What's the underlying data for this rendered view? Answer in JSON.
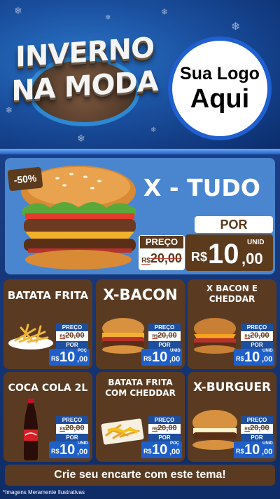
{
  "header": {
    "title_line1": "INVERNO",
    "title_line2": "NA MODA",
    "logo_line1": "Sua Logo",
    "logo_line2": "Aqui"
  },
  "featured": {
    "discount": "-50%",
    "name": "X - TUDO",
    "preco_label": "PREÇO",
    "old_currency": "R$",
    "old_price": "20,00",
    "por_label": "POR",
    "currency": "R$",
    "price_int": "10",
    "price_dec": ",00",
    "unit": "UNID"
  },
  "items": [
    {
      "name": "BATATA FRITA",
      "preco_label": "PREÇO",
      "old_currency": "R$",
      "old_price": "20,00",
      "por_label": "POR",
      "currency": "R$",
      "price_int": "10",
      "price_dec": ",00",
      "unit": "POÇ"
    },
    {
      "name": "X-BACON",
      "preco_label": "PREÇO",
      "old_currency": "R$",
      "old_price": "20,00",
      "por_label": "POR",
      "currency": "R$",
      "price_int": "10",
      "price_dec": ",00",
      "unit": "UNID"
    },
    {
      "name": "X BACON E CHEDDAR",
      "preco_label": "PREÇO",
      "old_currency": "R$",
      "old_price": "20,00",
      "por_label": "POR",
      "currency": "R$",
      "price_int": "10",
      "price_dec": ",00",
      "unit": "UNID"
    },
    {
      "name": "COCA COLA 2L",
      "preco_label": "PREÇO",
      "old_currency": "R$",
      "old_price": "20,00",
      "por_label": "POR",
      "currency": "R$",
      "price_int": "10",
      "price_dec": ",00",
      "unit": "UNID"
    },
    {
      "name": "BATATA FRITA COM CHEDDAR",
      "preco_label": "PREÇO",
      "old_currency": "R$",
      "old_price": "20,00",
      "por_label": "POR",
      "currency": "R$",
      "price_int": "10",
      "price_dec": ",00",
      "unit": "POÇ"
    },
    {
      "name": "X-BURGUER",
      "preco_label": "PREÇO",
      "old_currency": "R$",
      "old_price": "20,00",
      "por_label": "POR",
      "currency": "R$",
      "price_int": "10",
      "price_dec": ",00",
      "unit": "UNID"
    }
  ],
  "cta": "Crie seu encarte com este tema!",
  "footnote": "*Imagens Meramente Ilustrativas",
  "colors": {
    "brown": "#5a3b22",
    "blue_panel": "#4a86cf",
    "price_blue": "#1e5fc9",
    "background": "#0d2d6b"
  }
}
